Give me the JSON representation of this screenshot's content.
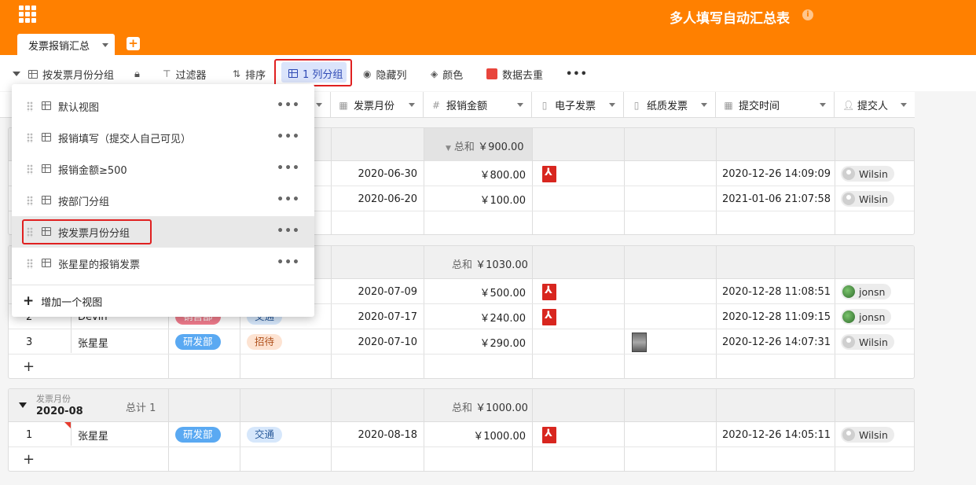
{
  "header": {
    "title": "多人填写自动汇总表",
    "info_icon": "info-icon",
    "tab_label": "发票报销汇总",
    "add_tab": "+"
  },
  "toolbar": {
    "view_name": "按发票月份分组",
    "filter": "过滤器",
    "sort": "排序",
    "group": "1 列分组",
    "hide": "隐藏列",
    "color": "颜色",
    "dedupe": "数据去重",
    "more": "•••"
  },
  "columns": [
    "发票月份",
    "报销金额",
    "电子发票",
    "纸质发票",
    "提交时间",
    "提交人"
  ],
  "column_icons": [
    "calendar-icon",
    "hash-icon",
    "paperclip-icon",
    "paperclip-icon",
    "calendar-icon",
    "person-icon"
  ],
  "groups": [
    {
      "sum_label": "总和",
      "sum_value": "￥900.00",
      "rows": [
        {
          "date": "2020-06-30",
          "amount": "￥800.00",
          "pdf": true,
          "submitted": "2020-12-26 14:09:09",
          "user": "Wilsin"
        },
        {
          "date": "2020-06-20",
          "amount": "￥100.00",
          "pdf": false,
          "submitted": "2021-01-06 21:07:58",
          "user": "Wilsin"
        }
      ]
    },
    {
      "sum_label": "总和",
      "sum_value": "￥1030.00",
      "rows": [
        {
          "date": "2020-07-09",
          "amount": "￥500.00",
          "pdf": true,
          "submitted": "2020-12-28 11:08:51",
          "user": "jonsn"
        },
        {
          "idx": "2",
          "name": "Devin",
          "dept": "销售部",
          "type": "交通",
          "date": "2020-07-17",
          "amount": "￥240.00",
          "pdf": true,
          "submitted": "2020-12-28 11:09:15",
          "user": "jonsn"
        },
        {
          "idx": "3",
          "name": "张星星",
          "dept": "研发部",
          "type": "招待",
          "date": "2020-07-10",
          "amount": "￥290.00",
          "pdf": false,
          "submitted": "2020-12-26 14:07:31",
          "user": "Wilsin"
        }
      ]
    },
    {
      "group_field": "发票月份",
      "group_value": "2020-08",
      "count_label": "总计 1",
      "sum_label": "总和",
      "sum_value": "￥1000.00",
      "rows": [
        {
          "idx": "1",
          "name": "张星星",
          "dept": "研发部",
          "type": "交通",
          "date": "2020-08-18",
          "amount": "￥1000.00",
          "pdf": true,
          "submitted": "2020-12-26 14:05:11",
          "user": "Wilsin"
        }
      ]
    }
  ],
  "add_row": "+",
  "views_menu": {
    "items": [
      "默认视图",
      "报销填写（提交人自己可见）",
      "报销金额≥500",
      "按部门分组",
      "按发票月份分组",
      "张星星的报销发票"
    ],
    "active_index": 4,
    "more": "•••",
    "add_view": "增加一个视图"
  },
  "colors": {
    "brand": "#ff8000",
    "highlight": "#e02020",
    "group_button_bg": "#dbe4fb"
  }
}
